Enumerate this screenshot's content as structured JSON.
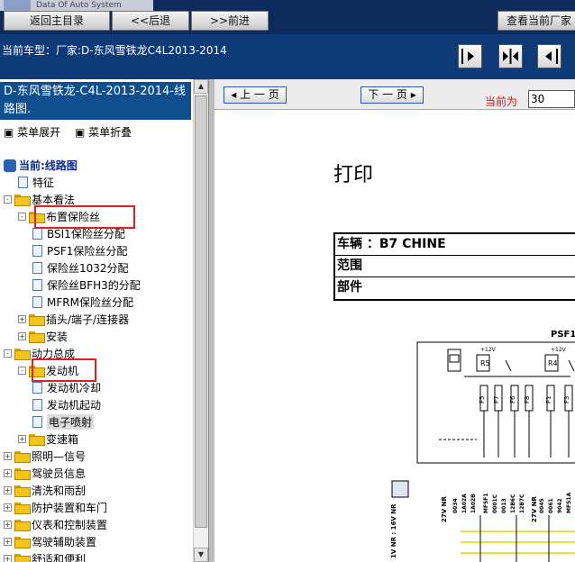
{
  "app": {
    "logo_text": "Data Of Auto System"
  },
  "nav": {
    "back_to_index": "返回主目录",
    "back": "<<后退",
    "forward": ">>前进",
    "view_current": "查看当前厂家"
  },
  "vehicle": {
    "line": "当前车型：厂家:D-东风雪铁龙C4L2013-2014"
  },
  "sidebar": {
    "title": "D-东风雪铁龙-C4L-2013-2014-线路图.",
    "expand_all": "菜单展开",
    "collapse_all": "菜单折叠",
    "tree": [
      {
        "label": "当前:线路图",
        "type": "root"
      },
      {
        "label": "特征",
        "type": "doc"
      },
      {
        "label": "基本看法",
        "type": "folder",
        "state": "-"
      },
      {
        "label": "布置保险丝",
        "type": "folder",
        "state": "-",
        "highlight": true
      },
      {
        "label": "BSI1保险丝分配",
        "type": "doc"
      },
      {
        "label": "PSF1保险丝分配",
        "type": "doc"
      },
      {
        "label": "保险丝1032分配",
        "type": "doc"
      },
      {
        "label": "保险丝BFH3的分配",
        "type": "doc"
      },
      {
        "label": "MFRM保险丝分配",
        "type": "doc"
      },
      {
        "label": "插头/端子/连接器",
        "type": "folder",
        "state": "+"
      },
      {
        "label": "安装",
        "type": "folder",
        "state": "+"
      },
      {
        "label": "动力总成",
        "type": "folder",
        "state": "-"
      },
      {
        "label": "发动机",
        "type": "folder",
        "state": "-",
        "highlight": true
      },
      {
        "label": "发动机冷却",
        "type": "doc"
      },
      {
        "label": "发动机起动",
        "type": "doc"
      },
      {
        "label": "电子喷射",
        "type": "doc",
        "selected": true
      },
      {
        "label": "变速箱",
        "type": "folder",
        "state": "+"
      },
      {
        "label": "照明—信号",
        "type": "folder",
        "state": "+"
      },
      {
        "label": "驾驶员信息",
        "type": "folder",
        "state": "+"
      },
      {
        "label": "清洗和雨刮",
        "type": "folder",
        "state": "+"
      },
      {
        "label": "防护装置和车门",
        "type": "folder",
        "state": "+"
      },
      {
        "label": "仪表和控制装置",
        "type": "folder",
        "state": "+"
      },
      {
        "label": "驾驶辅助装置",
        "type": "folder",
        "state": "+"
      },
      {
        "label": "舒适和便利",
        "type": "folder",
        "state": "+"
      }
    ]
  },
  "viewer": {
    "prev_page": "上 一 页",
    "next_page": "下 一 页",
    "current_label": "当前为",
    "current_page": "30",
    "print_title": "打印",
    "info_rows": [
      "车辆 ：B7 CHINE",
      "范围",
      "部件"
    ],
    "diagram_labels": {
      "psf": "PSF1",
      "r5": "R5",
      "r4": "R4",
      "f5": "F5",
      "f7": "F7",
      "f6": "F6",
      "f8": "F8",
      "f1": "F1",
      "f3": "F3",
      "v12a": "+12V",
      "v12b": "+12V",
      "nr1": "1V NR : 16V NR",
      "nr2": "27V NR",
      "nr3": "27V NR",
      "codes": [
        "0034",
        "1A02A",
        "1A02B",
        "MF5F1",
        "0001C",
        "0013",
        "12B6C",
        "12B7C",
        "0045",
        "0061",
        "9042",
        "MFS1A",
        "1600C"
      ]
    }
  },
  "colors": {
    "navy": "#0d2a5c",
    "blue_title": "#0f4f8f",
    "highlight_red": "#e02020"
  }
}
